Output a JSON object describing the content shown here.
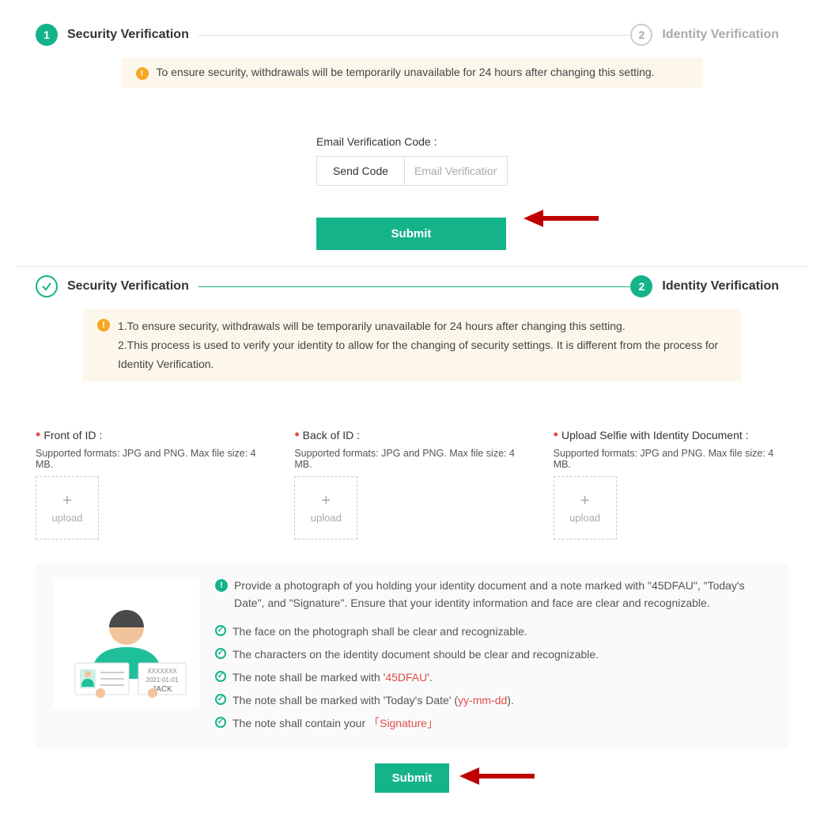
{
  "steps": {
    "sec1_num": "1",
    "sec1_label": "Security Verification",
    "sec2_num": "2",
    "sec2_label": "Identity Verification"
  },
  "notice1": "To ensure security, withdrawals will be temporarily unavailable for 24 hours after changing this setting.",
  "section1": {
    "field_label": "Email Verification Code :",
    "send_code": "Send Code",
    "placeholder": "Email Verification",
    "submit": "Submit"
  },
  "notice2": {
    "line1": "1.To ensure security, withdrawals will be temporarily unavailable for 24 hours after changing this setting.",
    "line2": "2.This process is used to verify your identity to allow for the changing of security settings. It is different from the process for Identity Verification."
  },
  "uploads": {
    "front_label": "Front of ID :",
    "back_label": "Back of ID :",
    "selfie_label": "Upload Selfie with Identity Document :",
    "support": "Supported formats: JPG and PNG. Max file size: 4 MB.",
    "upload_text": "upload"
  },
  "info": {
    "lead": "Provide a photograph of you holding your identity document and a note marked with \"45DFAU\", \"Today's Date\", and \"Signature\". Ensure that your identity information and face are clear and recognizable.",
    "check1": "The face on the photograph shall be clear and recognizable.",
    "check2": "The characters on the identity document should be clear and recognizable.",
    "check3_pre": "The note shall be marked with '",
    "check3_code": "45DFAU",
    "check3_post": "'.",
    "check4_pre": "The note shall be marked with 'Today's Date' (",
    "check4_fmt": "yy-mm-dd",
    "check4_post": ").",
    "check5_pre": "The note shall contain your ",
    "check5_sig": "Signature"
  },
  "illus": {
    "code": "XXXXXXX",
    "date": "2021-01-01",
    "name": "JACK"
  },
  "submit2": "Submit"
}
